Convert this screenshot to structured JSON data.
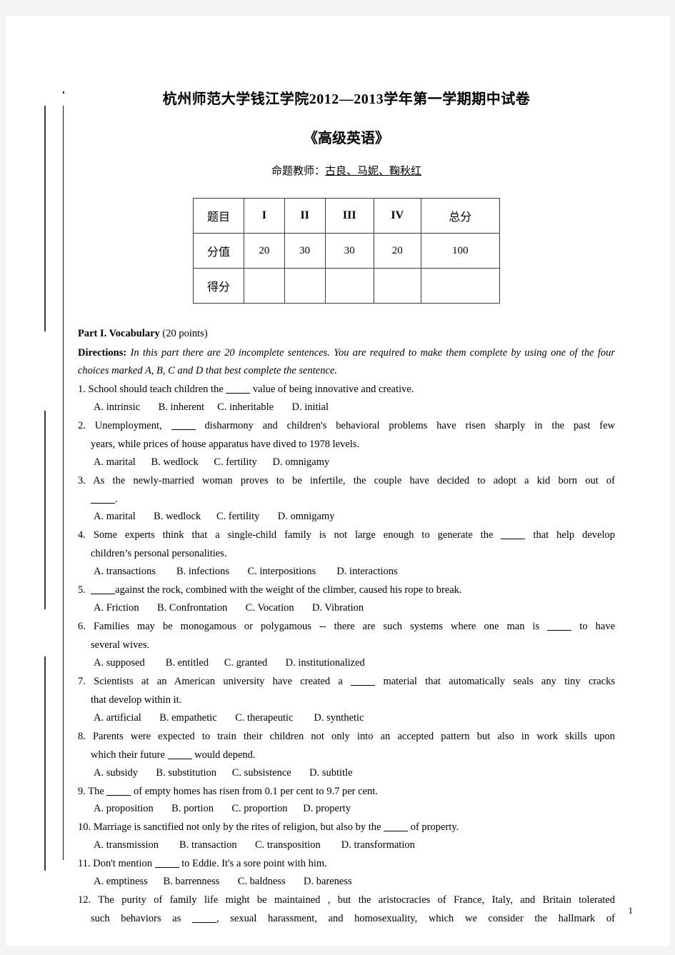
{
  "document": {
    "title_main": "杭州师范大学钱江学院2012—2013学年第一学期期中试卷",
    "title_sub": "《高级英语》",
    "teacher_label": "命题教师：",
    "teacher_names": "古良、马妮、鞠秋红",
    "page_number": "1"
  },
  "score_table": {
    "row_labels": [
      "题目",
      "分值",
      "得分"
    ],
    "columns": [
      "I",
      "II",
      "III",
      "IV",
      "总分"
    ],
    "scores": [
      "20",
      "30",
      "30",
      "20",
      "100"
    ],
    "scores_obtained": [
      "",
      "",
      "",
      "",
      ""
    ],
    "highlight_color": "#e8262b",
    "highlighted_column_index": 1
  },
  "part": {
    "heading_bold": "Part I. Vocabulary",
    "heading_points": "(20 points)",
    "directions_label": "Directions:",
    "directions_text": "In this part there are 20 incomplete sentences. You are required to make them complete by using one of the four choices marked A, B, C and D that best complete the sentence."
  },
  "questions": [
    {
      "number": "1.",
      "stem_a": "School should teach children the",
      "stem_b": "value of being innovative and creative.",
      "options": "A. intrinsic       B. inherent     C. inheritable       D. initial"
    },
    {
      "number": "2.",
      "stem_a": "Unemployment,",
      "stem_b": "disharmony and children's behavioral problems have risen sharply in the past few",
      "stem_cont": "years, while prices of house apparatus have dived to 1978 levels.",
      "options": "A. marital      B. wedlock      C. fertility      D. omnigamy"
    },
    {
      "number": "3.",
      "stem_a": "As the newly-married woman proves to be infertile, the couple have decided to adopt a kid born out of",
      "stem_cont_blank": ".",
      "options": "A. marital       B. wedlock      C. fertility       D. omnigamy"
    },
    {
      "number": "4.",
      "stem_a": "Some experts think that a single-child family is not large enough to generate the",
      "stem_b": "that help develop",
      "stem_cont": "children’s personal personalities.",
      "options": "A. transactions        B. infections       C. interpositions        D. interactions"
    },
    {
      "number": "5.",
      "stem_blank_first": "against the rock, combined with the weight of the climber, caused his rope to break.",
      "options": "A. Friction       B. Confrontation       C. Vocation       D. Vibration"
    },
    {
      "number": "6.",
      "stem_a": "Families may be monogamous or polygamous -- there are such systems where one man is",
      "stem_b": "to have",
      "stem_cont": "several wives.",
      "options": "A. supposed        B. entitled      C. granted       D. institutionalized"
    },
    {
      "number": "7.",
      "stem_a": "Scientists at an American university have created a",
      "stem_b": "material that automatically seals any tiny cracks",
      "stem_cont": "that develop within it.",
      "options": "A. artificial       B. empathetic       C. therapeutic        D. synthetic"
    },
    {
      "number": "8.",
      "stem_a": "Parents were expected to train their children not only into an accepted pattern but also in work skills upon",
      "stem_cont_a": "which their future",
      "stem_cont_b": "would depend.",
      "options": "A. subsidy       B. substitution      C. subsistence       D. subtitle"
    },
    {
      "number": "9.",
      "stem_a": "The",
      "stem_b": "of empty homes has risen from 0.1 per cent to 9.7 per cent.",
      "options": "A. proposition       B. portion       C. proportion      D. property"
    },
    {
      "number": "10.",
      "stem_a": "Marriage is sanctified not only by the rites of religion, but also by the",
      "stem_b": "of property.",
      "options": "A. transmission        B. transaction       C. transposition        D. transformation"
    },
    {
      "number": "11.",
      "stem_a": "Don't mention",
      "stem_b": "to Eddie. It's a sore point with him.",
      "options": "A. emptiness      B. barrenness       C. baldness       D. bareness"
    },
    {
      "number": "12.",
      "stem_a": "The purity of family life might be maintained , but the aristocracies of France, Italy, and Britain tolerated",
      "stem_cont_a": "such behaviors as",
      "stem_cont_b": ", sexual harassment, and homosexuality, which we consider the hallmark of"
    }
  ]
}
